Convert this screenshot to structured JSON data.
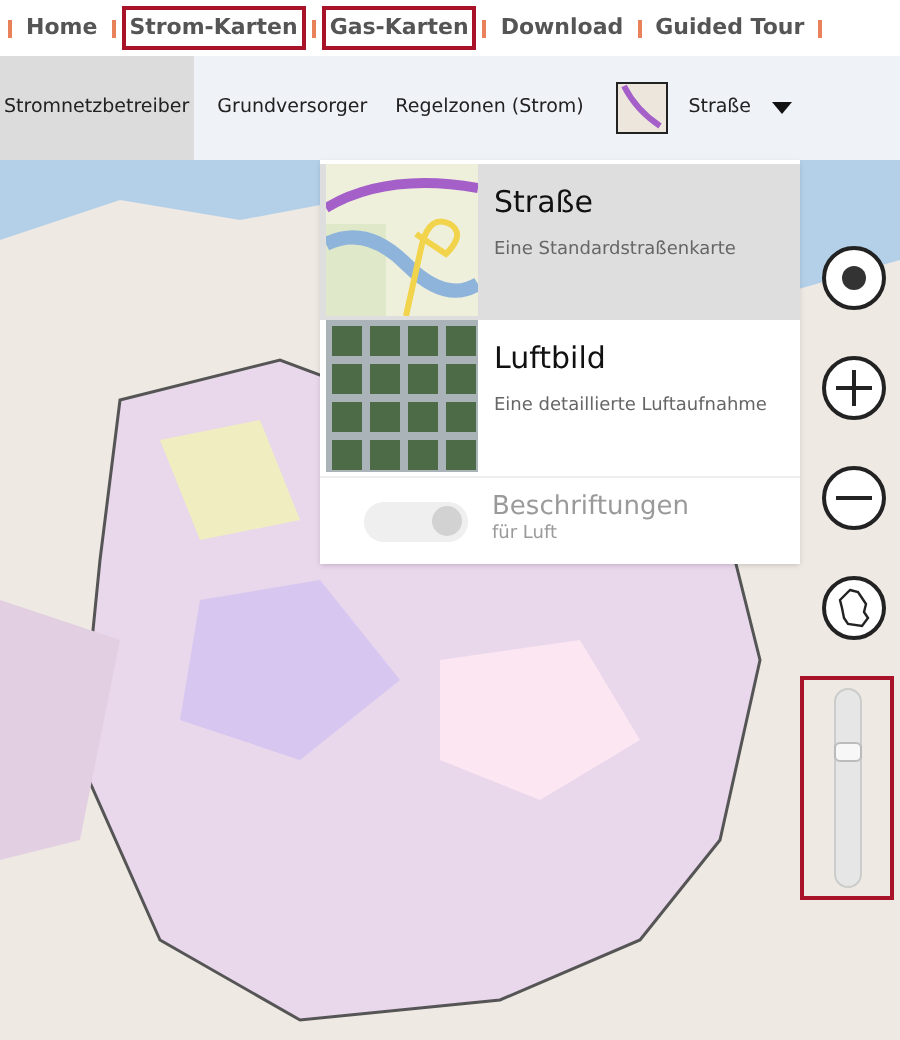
{
  "nav": [
    {
      "label": "Home",
      "highlighted": false
    },
    {
      "label": "Strom-Karten",
      "highlighted": true
    },
    {
      "label": "Gas-Karten",
      "highlighted": true
    },
    {
      "label": "Download",
      "highlighted": false
    },
    {
      "label": "Guided Tour",
      "highlighted": false
    }
  ],
  "layer_tabs": [
    {
      "label": "Stromnetzbetreiber",
      "selected": true
    },
    {
      "label": "Grundversorger",
      "selected": false
    },
    {
      "label": "Regelzonen (Strom)",
      "selected": false
    }
  ],
  "map_style": {
    "label": "Straße"
  },
  "style_menu": {
    "options": [
      {
        "kind": "road",
        "title": "Straße",
        "subtitle": "Eine Standardstraßenkarte",
        "selected": true
      },
      {
        "kind": "aerial",
        "title": "Luftbild",
        "subtitle": "Eine detaillierte Luftaufnahme",
        "selected": false
      }
    ],
    "labels_toggle": {
      "title": "Beschriftungen",
      "subtitle": "für Luft",
      "on": true,
      "disabled": true
    }
  },
  "zoom_slider": {
    "level": 0.72,
    "highlighted": true
  }
}
